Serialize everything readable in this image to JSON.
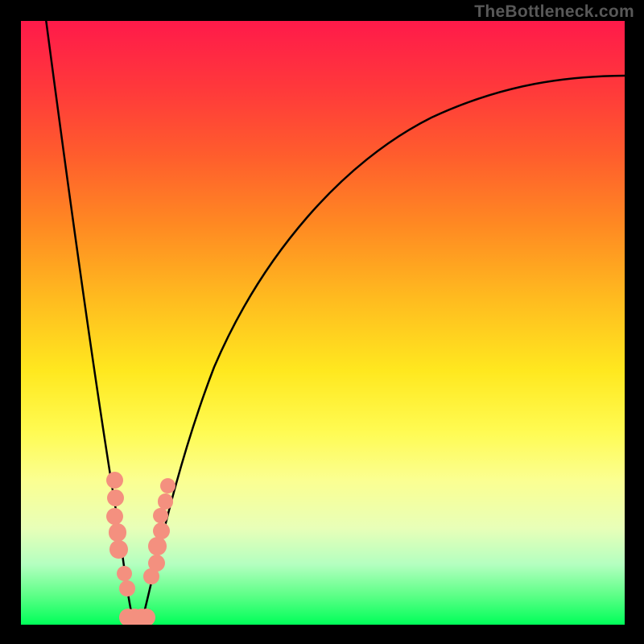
{
  "watermark": "TheBottleneck.com",
  "colors": {
    "background": "#000000",
    "curve_stroke": "#000000",
    "marker_fill": "#f4907f",
    "gradient_top": "#ff1a4a",
    "gradient_bottom": "#00ff59"
  },
  "chart_data": {
    "type": "line",
    "title": "",
    "xlabel": "",
    "ylabel": "",
    "xlim": [
      0,
      100
    ],
    "ylim": [
      0,
      100
    ],
    "grid": false,
    "series": [
      {
        "name": "left-branch",
        "x": [
          4,
          6,
          8,
          10,
          12,
          14,
          16,
          17.3,
          18
        ],
        "y": [
          100,
          80,
          62,
          46,
          32,
          20,
          9,
          2.5,
          0
        ]
      },
      {
        "name": "right-branch",
        "x": [
          20,
          22,
          24,
          26,
          30,
          35,
          40,
          45,
          50,
          55,
          60,
          65,
          70,
          75,
          80,
          85,
          90,
          95,
          100
        ],
        "y": [
          0,
          7,
          15,
          23,
          36,
          48,
          57,
          63,
          68.5,
          72.5,
          76,
          79,
          81.5,
          83.5,
          85.2,
          86.7,
          87.8,
          88.7,
          89.4
        ]
      },
      {
        "name": "valley-baseline",
        "x": [
          17.3,
          18,
          19,
          20,
          20.7
        ],
        "y": [
          2.5,
          0,
          0,
          0,
          2.5
        ]
      }
    ],
    "markers": {
      "name": "data-points",
      "points": [
        {
          "x": 15.5,
          "y": 24,
          "r": 1.4
        },
        {
          "x": 15.7,
          "y": 21,
          "r": 1.4
        },
        {
          "x": 15.5,
          "y": 18,
          "r": 1.4
        },
        {
          "x": 16.0,
          "y": 15.3,
          "r": 1.5
        },
        {
          "x": 16.2,
          "y": 12.5,
          "r": 1.5
        },
        {
          "x": 17.1,
          "y": 8.5,
          "r": 1.3
        },
        {
          "x": 17.6,
          "y": 6.0,
          "r": 1.3
        },
        {
          "x": 17.7,
          "y": 1.2,
          "r": 1.5
        },
        {
          "x": 18.8,
          "y": 1.2,
          "r": 1.5
        },
        {
          "x": 20.0,
          "y": 1.2,
          "r": 1.5
        },
        {
          "x": 20.8,
          "y": 1.2,
          "r": 1.5
        },
        {
          "x": 21.6,
          "y": 8.0,
          "r": 1.3
        },
        {
          "x": 22.4,
          "y": 10.2,
          "r": 1.4
        },
        {
          "x": 22.6,
          "y": 13.0,
          "r": 1.5
        },
        {
          "x": 23.2,
          "y": 15.5,
          "r": 1.4
        },
        {
          "x": 23.1,
          "y": 18.1,
          "r": 1.3
        },
        {
          "x": 23.9,
          "y": 20.4,
          "r": 1.3
        },
        {
          "x": 24.3,
          "y": 23.0,
          "r": 1.3
        }
      ]
    }
  }
}
